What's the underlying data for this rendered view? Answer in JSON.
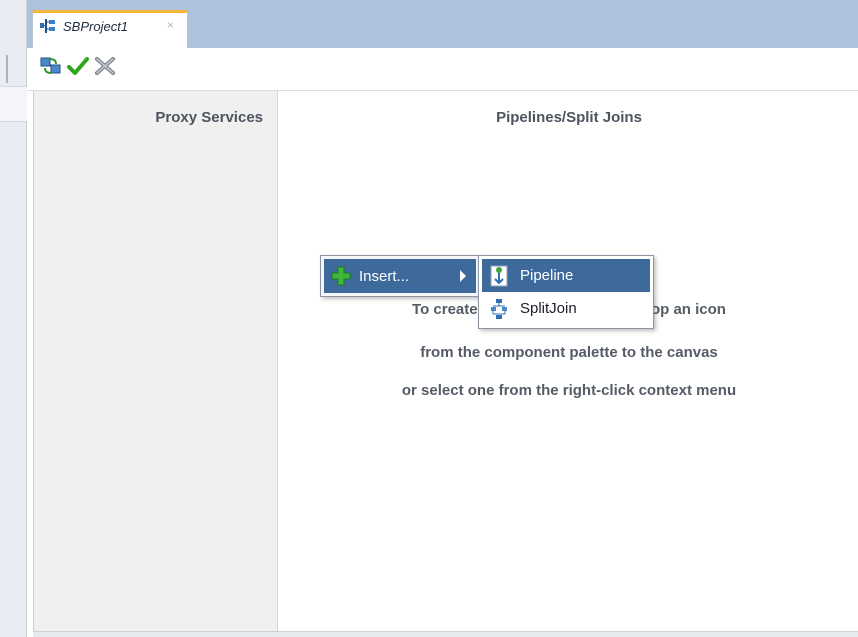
{
  "tab": {
    "title": "SBProject1",
    "close_glyph": "×"
  },
  "toolbar": {
    "buttons": [
      {
        "name": "refresh-icon"
      },
      {
        "name": "validate-check-icon"
      },
      {
        "name": "cancel-x-icon"
      }
    ]
  },
  "canvas": {
    "proxy_services_title": "Proxy Services",
    "pipelines_title": "Pipelines/Split Joins",
    "hint_line1": "To create re",
    "hint_line1_tail": "drop an icon",
    "hint_line2": "from the component palette to the canvas",
    "hint_line3": "or select one from the right-click context menu"
  },
  "context_menu": {
    "insert_label": "Insert...",
    "submenu": [
      {
        "label": "Pipeline",
        "selected": true
      },
      {
        "label": "SplitJoin",
        "selected": false
      }
    ]
  },
  "colors": {
    "tab_bar": "#aec2db",
    "tab_accent": "#f4b63a",
    "menu_selection": "#3d6a9a",
    "check_green": "#2ea51b"
  }
}
